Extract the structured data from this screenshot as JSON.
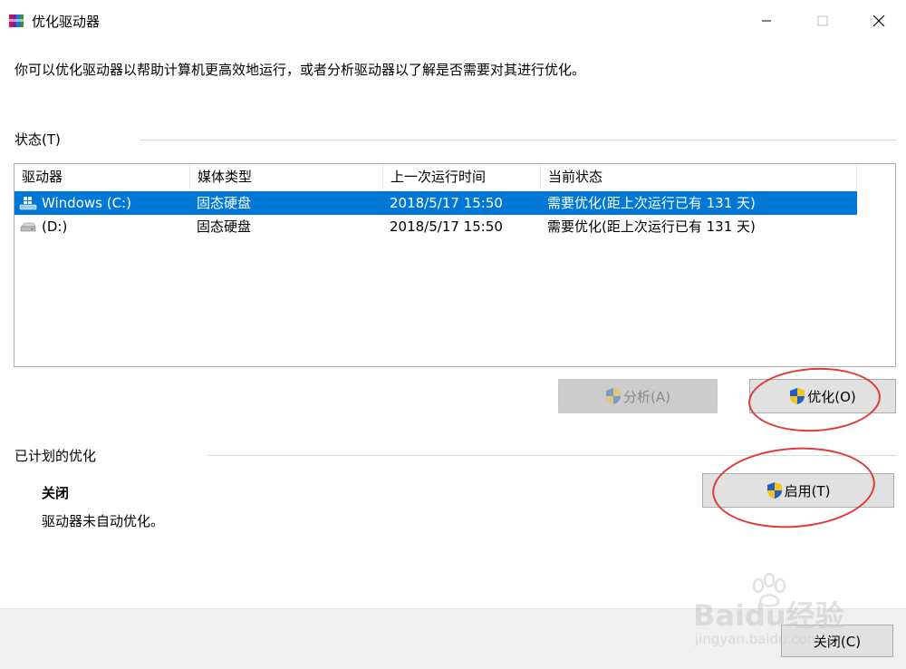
{
  "window": {
    "title": "优化驱动器",
    "icons": {
      "app": "defrag-app-icon",
      "minimize": "minimize-icon",
      "maximize": "maximize-icon",
      "close": "close-icon"
    }
  },
  "intro_text": "你可以优化驱动器以帮助计算机更高效地运行，或者分析驱动器以了解是否需要对其进行优化。",
  "status_group": {
    "label": "状态(T)",
    "columns": [
      "驱动器",
      "媒体类型",
      "上一次运行时间",
      "当前状态"
    ],
    "rows": [
      {
        "drive": "Windows (C:)",
        "media": "固态硬盘",
        "last_run": "2018/5/17 15:50",
        "status": "需要优化(距上次运行已有 131 天)",
        "selected": true,
        "icon": "windows-drive-icon"
      },
      {
        "drive": "(D:)",
        "media": "固态硬盘",
        "last_run": "2018/5/17 15:50",
        "status": "需要优化(距上次运行已有 131 天)",
        "selected": false,
        "icon": "drive-icon"
      }
    ]
  },
  "buttons": {
    "analyze": "分析(A)",
    "optimize": "优化(O)",
    "enable": "启用(T)",
    "close": "关闭(C)"
  },
  "schedule_group": {
    "label": "已计划的优化",
    "state": "关闭",
    "description": "驱动器未自动优化。"
  },
  "watermark": {
    "brand": "Baidu经验",
    "url": "jingyan.baidu.com"
  },
  "colors": {
    "selection": "#0078d7",
    "annotation": "#e23a3a",
    "shield_blue": "#1d5fc5",
    "shield_yellow": "#f5c518"
  }
}
